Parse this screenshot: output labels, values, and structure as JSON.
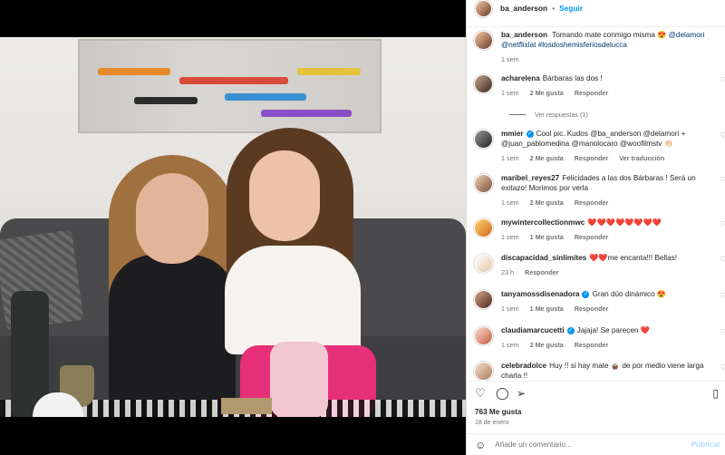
{
  "post": {
    "username": "ba_anderson",
    "separator": "•",
    "follow_label": "Seguir"
  },
  "caption": {
    "username": "ba_anderson",
    "text": "Tomando mate conmigo misma 😍",
    "mention_1": "@delamori",
    "mention_2": "@netflixlat",
    "hashtag": "#losdoshemisferiosdelucca",
    "time": "1 sem"
  },
  "comments": [
    {
      "user": "acharelena",
      "text": "Bárbaras las dos !",
      "time": "1 sem",
      "likes": "2 Me gusta",
      "reply": "Responder",
      "view_replies": "Ver respuestas (1)"
    },
    {
      "user": "mmier",
      "text": "Cool pic. Kudos @ba_anderson @delamori + @juan_pablomedina @manolocaro @woofilmstv 👏🏻",
      "time": "1 sem",
      "likes": "2 Me gusta",
      "reply": "Responder",
      "translate": "Ver traducción"
    },
    {
      "user": "maribel_reyes27",
      "text": "Felicidades a las dos Bárbaras ! Será un exitazo! Morimos por verla",
      "time": "1 sem",
      "likes": "2 Me gusta",
      "reply": "Responder"
    },
    {
      "user": "mywintercollectionmwc",
      "text": "❤️❤️❤️❤️❤️❤️❤️❤️",
      "time": "1 sem",
      "likes": "1 Me gusta",
      "reply": "Responder"
    },
    {
      "user": "discapacidad_sinlimites",
      "text": "❤️❤️me encanta!!! Bellas!",
      "time": "23 h",
      "reply": "Responder"
    },
    {
      "user": "tanyamossdisenadora",
      "text": "Gran dúo dinámico 😍",
      "time": "1 sem",
      "likes": "1 Me gusta",
      "reply": "Responder"
    },
    {
      "user": "claudiamarcucetti",
      "text": "Jajaja! Se parecen ❤️",
      "time": "1 sem",
      "likes": "2 Me gusta",
      "reply": "Responder"
    },
    {
      "user": "celebradolce",
      "text": "Huy !! si hay mate 🧉 de por medio viene larga charla !!"
    }
  ],
  "actions": {
    "like_icon": "heart-icon",
    "comment_icon": "comment-icon",
    "share_icon": "share-icon",
    "save_icon": "bookmark-icon",
    "likes_count": "763 Me gusta",
    "date": "18 de enero"
  },
  "comment_box": {
    "placeholder": "Añade un comentario...",
    "publish_label": "Publicar"
  },
  "colors": {
    "accent": "#0095f6",
    "heart": "#ed1c3b"
  }
}
